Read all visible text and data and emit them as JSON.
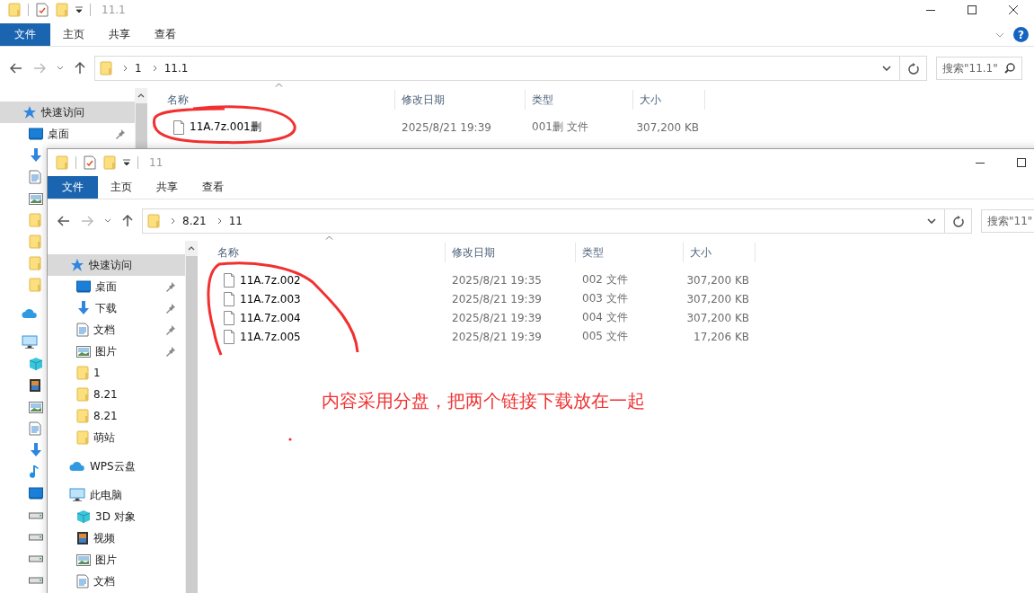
{
  "windows": [
    {
      "kind": "back",
      "title": "11.1",
      "controls": [
        {
          "kind": "minimize"
        },
        {
          "kind": "maximize"
        },
        {
          "kind": "close"
        }
      ],
      "ribbon_tabs": [
        {
          "kind": "file-menu",
          "label": "文件"
        },
        {
          "kind": "tab",
          "label": "主页"
        },
        {
          "kind": "tab",
          "label": "共享"
        },
        {
          "kind": "tab",
          "label": "查看"
        }
      ],
      "help_glyph": "?",
      "address": {
        "crumbs": [
          "1",
          "11.1"
        ],
        "search_placeholder": "搜索\"11.1\""
      },
      "nav": [
        {
          "kind": "star",
          "label": "快速访问",
          "selected": true,
          "children": [
            {
              "kind": "desktop",
              "label": "桌面",
              "selected": false,
              "pinned": true
            },
            {
              "kind": "download",
              "selected": false
            },
            {
              "kind": "document",
              "selected": false
            },
            {
              "kind": "picture",
              "selected": false
            },
            {
              "kind": "folder",
              "selected": false
            },
            {
              "kind": "folder",
              "selected": false
            },
            {
              "kind": "folder",
              "selected": false
            },
            {
              "kind": "folder",
              "selected": false
            }
          ]
        },
        {
          "kind": "cloud",
          "selected": false
        },
        {
          "kind": "computer",
          "selected": false,
          "children": [
            {
              "kind": "cube",
              "selected": false
            },
            {
              "kind": "film",
              "selected": false
            },
            {
              "kind": "picture",
              "selected": false
            },
            {
              "kind": "document",
              "selected": false
            },
            {
              "kind": "download",
              "selected": false
            },
            {
              "kind": "music",
              "selected": false
            },
            {
              "kind": "desktop",
              "selected": false
            },
            {
              "kind": "drive",
              "selected": false
            },
            {
              "kind": "drive",
              "selected": false
            },
            {
              "kind": "drive",
              "selected": false
            },
            {
              "kind": "drive",
              "selected": false
            }
          ]
        }
      ],
      "columns": [
        "名称",
        "修改日期",
        "类型",
        "大小"
      ],
      "files": [
        {
          "name": "11A.7z.001删",
          "modified": "2025/8/21 19:39",
          "type": "001删 文件",
          "size": "307,200 KB"
        }
      ]
    },
    {
      "kind": "front",
      "title": "11",
      "controls": [
        {
          "kind": "minimize"
        },
        {
          "kind": "maximize"
        }
      ],
      "ribbon_tabs": [
        {
          "kind": "file-menu",
          "label": "文件"
        },
        {
          "kind": "tab",
          "label": "主页"
        },
        {
          "kind": "tab",
          "label": "共享"
        },
        {
          "kind": "tab",
          "label": "查看"
        }
      ],
      "address": {
        "crumbs": [
          "8.21",
          "11"
        ],
        "search_placeholder": "搜索\"11\""
      },
      "nav": [
        {
          "kind": "star",
          "label": "快速访问",
          "selected": true,
          "children": [
            {
              "kind": "desktop",
              "label": "桌面",
              "selected": false,
              "pinned": true
            },
            {
              "kind": "download",
              "label": "下载",
              "selected": false,
              "pinned": true
            },
            {
              "kind": "document",
              "label": "文档",
              "selected": false,
              "pinned": true
            },
            {
              "kind": "picture",
              "label": "图片",
              "selected": false,
              "pinned": true
            },
            {
              "kind": "folder",
              "label": "1",
              "selected": false,
              "pinned": false
            },
            {
              "kind": "folder",
              "label": "8.21",
              "selected": false,
              "pinned": false
            },
            {
              "kind": "folder",
              "label": "8.21",
              "selected": false,
              "pinned": false
            },
            {
              "kind": "folder",
              "label": "萌站",
              "selected": false,
              "pinned": false
            }
          ]
        },
        {
          "kind": "cloud",
          "label": "WPS云盘",
          "selected": false
        },
        {
          "kind": "computer",
          "label": "此电脑",
          "selected": false,
          "children": [
            {
              "kind": "cube",
              "label": "3D 对象",
              "selected": false
            },
            {
              "kind": "film",
              "label": "视频",
              "selected": false
            },
            {
              "kind": "picture",
              "label": "图片",
              "selected": false
            },
            {
              "kind": "document",
              "label": "文档",
              "selected": false
            }
          ]
        }
      ],
      "columns": [
        "名称",
        "修改日期",
        "类型",
        "大小"
      ],
      "files": [
        {
          "name": "11A.7z.002",
          "modified": "2025/8/21 19:35",
          "type": "002 文件",
          "size": "307,200 KB"
        },
        {
          "name": "11A.7z.003",
          "modified": "2025/8/21 19:39",
          "type": "003 文件",
          "size": "307,200 KB"
        },
        {
          "name": "11A.7z.004",
          "modified": "2025/8/21 19:39",
          "type": "004 文件",
          "size": "307,200 KB"
        },
        {
          "name": "11A.7z.005",
          "modified": "2025/8/21 19:39",
          "type": "005 文件",
          "size": "17,206 KB"
        }
      ]
    }
  ],
  "annotation": {
    "text": "内容采用分盘，把两个链接下载放在一起"
  }
}
